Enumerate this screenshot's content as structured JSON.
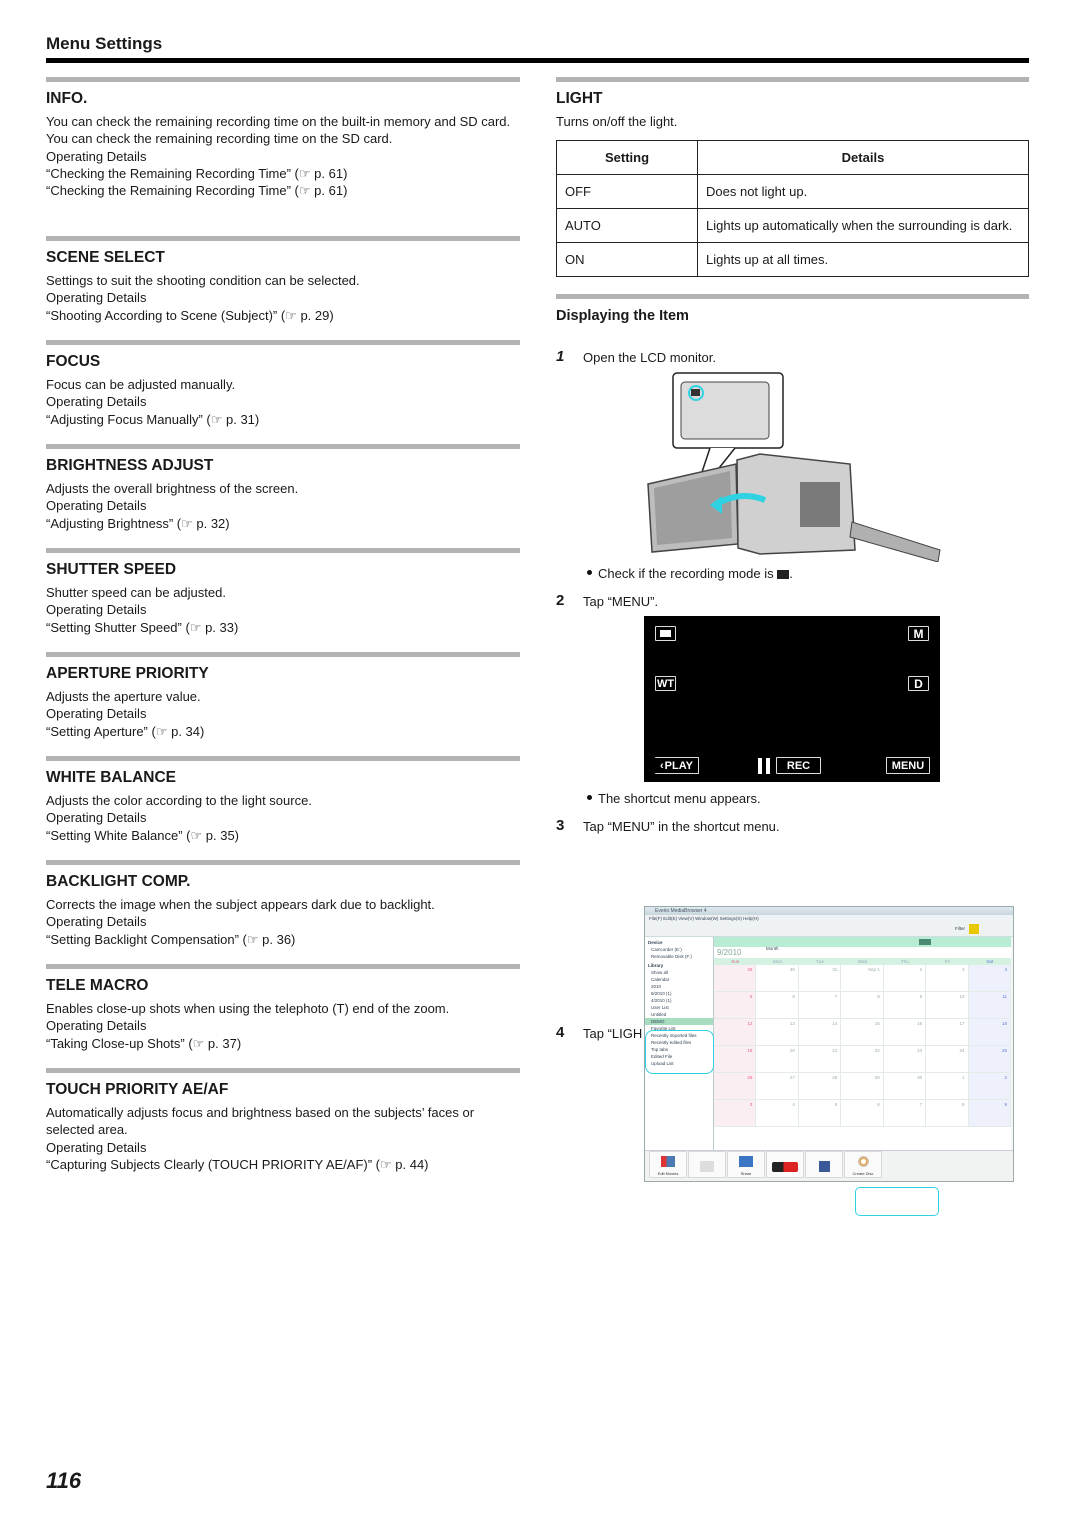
{
  "header": {
    "title": "Menu Settings"
  },
  "left_sections": [
    {
      "title": "INFO.",
      "lines": [
        "You can check the remaining recording time on the built-in memory and SD card.",
        "You can check the remaining recording time on the SD card.",
        "Operating Details",
        "“Checking the Remaining Recording Time” (☞ p. 61)",
        "“Checking the Remaining Recording Time” (☞ p. 61)"
      ]
    },
    {
      "title": "SCENE SELECT",
      "lines": [
        "Settings to suit the shooting condition can be selected.",
        "Operating Details",
        "“Shooting According to Scene (Subject)” (☞ p. 29)"
      ]
    },
    {
      "title": "FOCUS",
      "lines": [
        "Focus can be adjusted manually.",
        "Operating Details",
        "“Adjusting Focus Manually” (☞ p. 31)"
      ]
    },
    {
      "title": "BRIGHTNESS ADJUST",
      "lines": [
        "Adjusts the overall brightness of the screen.",
        "Operating Details",
        "“Adjusting Brightness” (☞ p. 32)"
      ]
    },
    {
      "title": "SHUTTER SPEED",
      "lines": [
        "Shutter speed can be adjusted.",
        "Operating Details",
        "“Setting Shutter Speed” (☞ p. 33)"
      ]
    },
    {
      "title": "APERTURE PRIORITY",
      "lines": [
        "Adjusts the aperture value.",
        "Operating Details",
        "“Setting Aperture” (☞ p. 34)"
      ]
    },
    {
      "title": "WHITE BALANCE",
      "lines": [
        "Adjusts the color according to the light source.",
        "Operating Details",
        "“Setting White Balance” (☞ p. 35)"
      ]
    },
    {
      "title": "BACKLIGHT COMP.",
      "lines": [
        "Corrects the image when the subject appears dark due to backlight.",
        "Operating Details",
        "“Setting Backlight Compensation” (☞ p. 36)"
      ]
    },
    {
      "title": "TELE MACRO",
      "lines": [
        "Enables close-up shots when using the telephoto (T) end of the zoom.",
        "Operating Details",
        "“Taking Close-up Shots” (☞ p. 37)"
      ]
    },
    {
      "title": "TOUCH PRIORITY AE/AF",
      "lines": [
        "Automatically adjusts focus and brightness based on the subjects’ faces or selected area.",
        "Operating Details",
        "“Capturing Subjects Clearly (TOUCH PRIORITY AE/AF)” (☞ p. 44)"
      ]
    }
  ],
  "light": {
    "title": "LIGHT",
    "description": "Turns on/off the light.",
    "table": {
      "headers": [
        "Setting",
        "Details"
      ],
      "rows": [
        [
          "OFF",
          "Does not light up."
        ],
        [
          "AUTO",
          "Lights up automatically when the surrounding is dark."
        ],
        [
          "ON",
          "Lights up at all times."
        ]
      ]
    }
  },
  "displaying": {
    "title": "Displaying the Item",
    "steps": [
      {
        "num": "1",
        "text": "Open the LCD monitor."
      },
      {
        "num": "2",
        "text": "Tap “MENU”."
      },
      {
        "num": "3",
        "text": "Tap “MENU” in the shortcut menu."
      },
      {
        "num": "4",
        "text": "Tap “LIGH"
      }
    ],
    "bullets": [
      "Check if the recording mode is ",
      "The shortcut menu appears."
    ]
  },
  "lcd": {
    "mode_icon": "video-camera-icon",
    "buttons": {
      "m": "M",
      "wt": "WT",
      "d": "D",
      "play": "PLAY",
      "rec": "REC",
      "menu": "MENU"
    }
  },
  "app": {
    "window_title": "Everio MediaBrowser 4",
    "menu": "File(F)  Edit(E)  View(V)  Window(W)  Settings(S)  Help(H)",
    "filter": "Filter",
    "sidebar": [
      "Device",
      "Camcorder (E:)",
      "Removable Disk (F:)",
      "Library",
      "Show all",
      "Calendar",
      "2010",
      "9/2010 (1)",
      "4/2010 (1)",
      "User List",
      "Untitled",
      "DEMO",
      "Favorite List",
      "Recently imported files",
      "Recently edited files",
      "Top tabs",
      "Edited File",
      "Upload List"
    ],
    "month_label": "Month",
    "month_title": "9/2010",
    "weekdays": [
      "Sun",
      "Mon",
      "Tue",
      "Wed",
      "Thu",
      "Fri",
      "Sat"
    ],
    "weeks": [
      [
        "29",
        "30",
        "31",
        "Sep 1",
        "2",
        "3",
        "4"
      ],
      [
        "5",
        "6",
        "7",
        "8",
        "9",
        "10",
        "11"
      ],
      [
        "12",
        "13",
        "14",
        "15",
        "16",
        "17",
        "18"
      ],
      [
        "19",
        "20",
        "21",
        "22",
        "23",
        "24",
        "25"
      ],
      [
        "26",
        "27",
        "28",
        "29",
        "30",
        "1",
        "2"
      ],
      [
        "3",
        "4",
        "5",
        "6",
        "7",
        "8",
        "9"
      ]
    ],
    "bottom_buttons": [
      "Edit Movies",
      "",
      "Share",
      "YouTube",
      "f",
      "Create Disc"
    ]
  },
  "footer": {
    "page_number": "116"
  },
  "colors": {
    "rule_gray": "#b3b3b3",
    "callout_cyan": "#2fd2e2",
    "sun_red": "#e06088",
    "sat_blue": "#5a78d8"
  }
}
